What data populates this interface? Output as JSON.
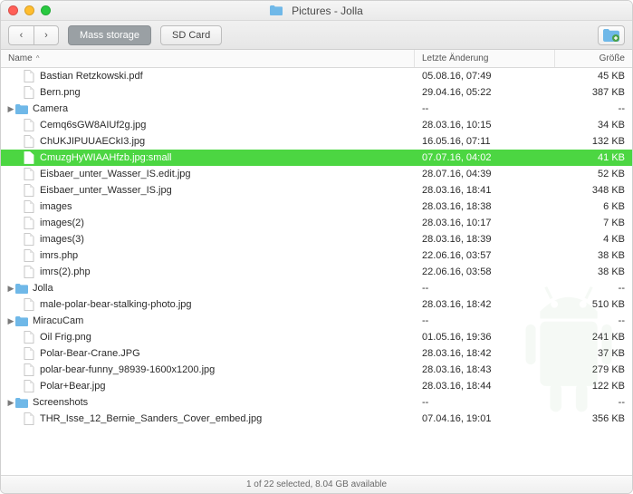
{
  "window": {
    "title": "Pictures - Jolla",
    "folder_icon": "folder"
  },
  "toolbar": {
    "back_label": "<",
    "fwd_label": ">",
    "tab1": "Mass storage",
    "tab2": "SD Card"
  },
  "columns": {
    "name": "Name",
    "date": "Letzte Änderung",
    "size": "Größe",
    "sort_indicator": "^"
  },
  "files": [
    {
      "name": "Bastian Retzkowski.pdf",
      "date": "05.08.16, 07:49",
      "size": "45 KB",
      "icon": "file",
      "indent": 1
    },
    {
      "name": "Bern.png",
      "date": "29.04.16, 05:22",
      "size": "387 KB",
      "icon": "file",
      "indent": 1
    },
    {
      "name": "Camera",
      "date": "--",
      "size": "--",
      "icon": "folder",
      "indent": 0,
      "disclose": true
    },
    {
      "name": "Cemq6sGW8AIUf2g.jpg",
      "date": "28.03.16, 10:15",
      "size": "34 KB",
      "icon": "file",
      "indent": 1
    },
    {
      "name": "ChUKJIPUUAECkI3.jpg",
      "date": "16.05.16, 07:11",
      "size": "132 KB",
      "icon": "file",
      "indent": 1
    },
    {
      "name": "CmuzgHyWIAAHfzb.jpg:small",
      "date": "07.07.16, 04:02",
      "size": "41 KB",
      "icon": "file",
      "indent": 1,
      "selected": true
    },
    {
      "name": "Eisbaer_unter_Wasser_IS.edit.jpg",
      "date": "28.07.16, 04:39",
      "size": "52 KB",
      "icon": "file",
      "indent": 1
    },
    {
      "name": "Eisbaer_unter_Wasser_IS.jpg",
      "date": "28.03.16, 18:41",
      "size": "348 KB",
      "icon": "file",
      "indent": 1
    },
    {
      "name": "images",
      "date": "28.03.16, 18:38",
      "size": "6 KB",
      "icon": "file",
      "indent": 1
    },
    {
      "name": "images(2)",
      "date": "28.03.16, 10:17",
      "size": "7 KB",
      "icon": "file",
      "indent": 1
    },
    {
      "name": "images(3)",
      "date": "28.03.16, 18:39",
      "size": "4 KB",
      "icon": "file",
      "indent": 1
    },
    {
      "name": "imrs.php",
      "date": "22.06.16, 03:57",
      "size": "38 KB",
      "icon": "file",
      "indent": 1
    },
    {
      "name": "imrs(2).php",
      "date": "22.06.16, 03:58",
      "size": "38 KB",
      "icon": "file",
      "indent": 1
    },
    {
      "name": "Jolla",
      "date": "--",
      "size": "--",
      "icon": "folder",
      "indent": 0,
      "disclose": true
    },
    {
      "name": "male-polar-bear-stalking-photo.jpg",
      "date": "28.03.16, 18:42",
      "size": "510 KB",
      "icon": "file",
      "indent": 1
    },
    {
      "name": "MiracuCam",
      "date": "--",
      "size": "--",
      "icon": "folder",
      "indent": 0,
      "disclose": true
    },
    {
      "name": "Oil Frig.png",
      "date": "01.05.16, 19:36",
      "size": "241 KB",
      "icon": "file",
      "indent": 1
    },
    {
      "name": "Polar-Bear-Crane.JPG",
      "date": "28.03.16, 18:42",
      "size": "37 KB",
      "icon": "file",
      "indent": 1
    },
    {
      "name": "polar-bear-funny_98939-1600x1200.jpg",
      "date": "28.03.16, 18:43",
      "size": "279 KB",
      "icon": "file",
      "indent": 1
    },
    {
      "name": "Polar+Bear.jpg",
      "date": "28.03.16, 18:44",
      "size": "122 KB",
      "icon": "file",
      "indent": 1
    },
    {
      "name": "Screenshots",
      "date": "--",
      "size": "--",
      "icon": "folder",
      "indent": 0,
      "disclose": true
    },
    {
      "name": "THR_Isse_12_Bernie_Sanders_Cover_embed.jpg",
      "date": "07.04.16, 19:01",
      "size": "356 KB",
      "icon": "file",
      "indent": 1
    }
  ],
  "status": "1 of 22 selected, 8.04 GB available"
}
